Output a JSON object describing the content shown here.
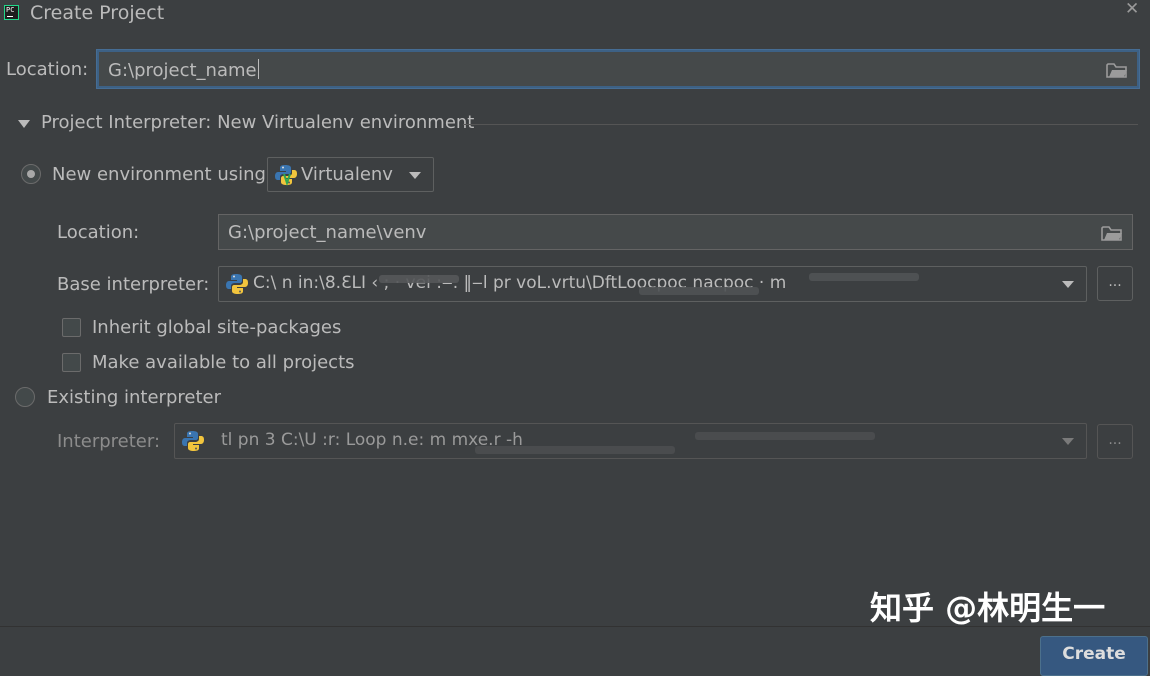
{
  "window": {
    "title": "Create Project",
    "close_glyph": "✕",
    "app_icon": "pycharm-icon"
  },
  "project_location": {
    "label": "Location:",
    "value": "G:\\project_name",
    "icon": "folder-icon"
  },
  "interpreter_section": {
    "header": "Project Interpreter: New Virtualenv environment",
    "expanded": true
  },
  "new_environment": {
    "radio_label": "New environment using",
    "selected": true,
    "tool_select": "Virtualenv",
    "location_label": "Location:",
    "location_value": "G:\\project_name\\venv",
    "base_interpreter_label": "Base interpreter:",
    "base_interpreter_value": "C:\\  n in:\\8.ƐLI  ‹  ;  ·  vei  :‒.  ‖‒l pr voL.vrtu\\DftLoocpoc  nacpoc  ·  m",
    "browse_label": "...",
    "inherit_label": "Inherit global site-packages",
    "inherit_checked": false,
    "make_available_label": "Make available to all projects",
    "make_available_checked": false
  },
  "existing_interpreter": {
    "radio_label": "Existing interpreter",
    "selected": false,
    "interpreter_label": "Interpreter:",
    "interpreter_value": "tl pn 3  C:\\U   :r:  Loop   n.e:   m   mxe.r   -h",
    "browse_label": "..."
  },
  "footer": {
    "create_label": "Create"
  },
  "watermark": "知乎 @林明生一",
  "colors": {
    "background": "#3c3f41",
    "text": "#bbbbbb",
    "focus_border": "#3d6185",
    "primary_button": "#365880"
  }
}
